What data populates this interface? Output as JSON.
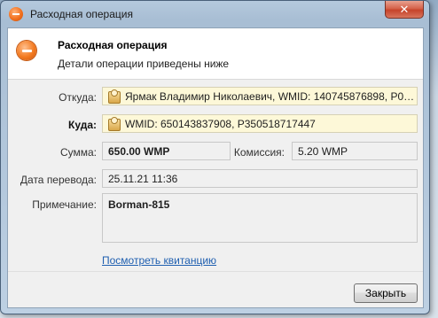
{
  "window": {
    "title": "Расходная операция"
  },
  "header": {
    "title": "Расходная операция",
    "subtitle": "Детали операции приведены ниже"
  },
  "fields": {
    "from_label": "Откуда:",
    "from_value": "Ярмак Владимир Николаевич, WMID: 140745876898, P0229374...",
    "to_label": "Куда:",
    "to_value": "WMID: 650143837908, P350518717447",
    "amount_label": "Сумма:",
    "amount_value": "650.00 WMP",
    "fee_label": "Комиссия:",
    "fee_value": "5.20 WMP",
    "date_label": "Дата перевода:",
    "date_value": "25.11.21 11:36",
    "note_label": "Примечание:",
    "note_value": "Borman-815"
  },
  "receipt_link": "Посмотреть квитанцию",
  "buttons": {
    "close_label": "Закрыть",
    "window_close_glyph": "✕"
  },
  "icons": {
    "title_icon": "minus-circle-icon",
    "header_icon": "minus-circle-icon",
    "wallet_icon": "wm-passport-icon"
  },
  "colors": {
    "accent_orange": "#f37a20",
    "link_blue": "#1f5fb0",
    "highlight_field": "#fdf8d8"
  }
}
